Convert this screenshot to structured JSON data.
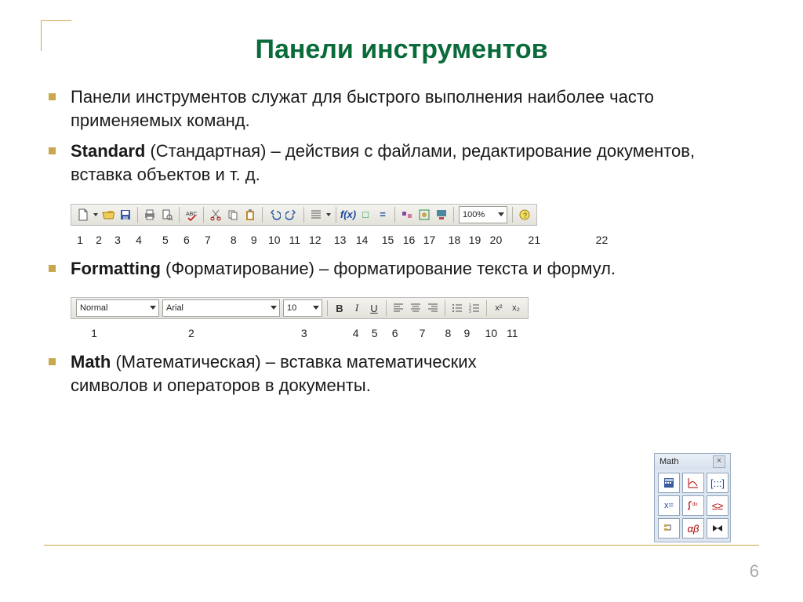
{
  "title": "Панели инструментов",
  "bullets": {
    "b1": "Панели инструментов служат для быстрого выполнения наиболее часто применяемых команд.",
    "b2_bold": "Standard",
    "b2_rest": " (Стандартная)  – действия с файлами, редактирование документов, вставка объектов и т. д.",
    "b3_bold": "Formatting",
    "b3_rest": " (Форматирование)  – форматирование текста и формул.",
    "b4_bold": "Math",
    "b4_rest": " (Математическая)  – вставка математических символов и операторов в документы."
  },
  "std_numbers": [
    "1",
    "2",
    "3",
    "4",
    "5",
    "6",
    "7",
    "8",
    "9",
    "10",
    "11",
    "12",
    "13",
    "14",
    "15",
    "16",
    "17",
    "18",
    "19",
    "20",
    "21",
    "22"
  ],
  "std_zoom": "100%",
  "fmt_numbers": [
    "1",
    "2",
    "3",
    "4",
    "5",
    "6",
    "7",
    "8",
    "9",
    "10",
    "11"
  ],
  "fmt": {
    "style": "Normal",
    "font": "Arial",
    "size": "10"
  },
  "math_title": "Math",
  "page_number": "6"
}
